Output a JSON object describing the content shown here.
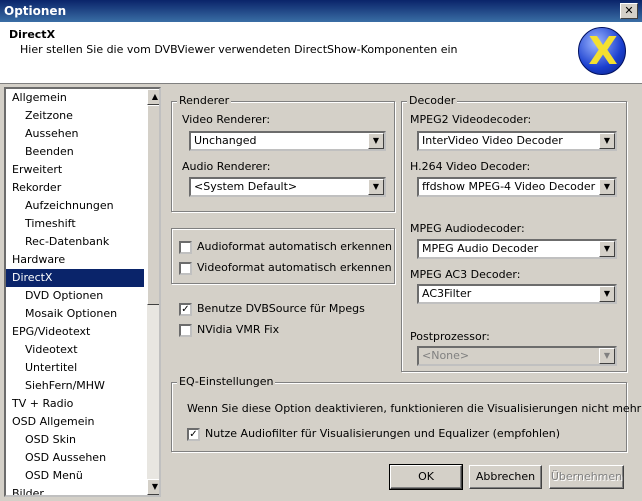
{
  "window": {
    "title": "Optionen"
  },
  "header": {
    "title": "DirectX",
    "subtitle": "Hier stellen Sie die vom DVBViewer verwendeten DirectShow-Komponenten ein"
  },
  "tree": {
    "items": [
      {
        "label": "Allgemein",
        "level": 1
      },
      {
        "label": "Zeitzone",
        "level": 2
      },
      {
        "label": "Aussehen",
        "level": 2
      },
      {
        "label": "Beenden",
        "level": 2
      },
      {
        "label": "Erweitert",
        "level": 1
      },
      {
        "label": "Rekorder",
        "level": 1
      },
      {
        "label": "Aufzeichnungen",
        "level": 2
      },
      {
        "label": "Timeshift",
        "level": 2
      },
      {
        "label": "Rec-Datenbank",
        "level": 2
      },
      {
        "label": "Hardware",
        "level": 1
      },
      {
        "label": "DirectX",
        "level": 1,
        "selected": true
      },
      {
        "label": "DVD Optionen",
        "level": 2
      },
      {
        "label": "Mosaik Optionen",
        "level": 2
      },
      {
        "label": "EPG/Videotext",
        "level": 1
      },
      {
        "label": "Videotext",
        "level": 2
      },
      {
        "label": "Untertitel",
        "level": 2
      },
      {
        "label": "SiehFern/MHW",
        "level": 2
      },
      {
        "label": "TV + Radio",
        "level": 1
      },
      {
        "label": "OSD Allgemein",
        "level": 1
      },
      {
        "label": "OSD Skin",
        "level": 2
      },
      {
        "label": "OSD Aussehen",
        "level": 2
      },
      {
        "label": "OSD Menü",
        "level": 2
      },
      {
        "label": "Bilder",
        "level": 1
      }
    ]
  },
  "renderer": {
    "group_title": "Renderer",
    "video_label": "Video Renderer:",
    "video_value": "Unchanged",
    "audio_label": "Audio Renderer:",
    "audio_value": "<System Default>"
  },
  "autodetect": {
    "audio_label": "Audioformat automatisch erkennen",
    "audio_checked": false,
    "video_label": "Videoformat automatisch erkennen",
    "video_checked": false
  },
  "misc": {
    "dvbsource_label": "Benutze DVBSource für Mpegs",
    "dvbsource_checked": true,
    "vmr_label": "NVidia VMR Fix",
    "vmr_checked": false
  },
  "decoder": {
    "group_title": "Decoder",
    "mpeg2_label": "MPEG2 Videodecoder:",
    "mpeg2_value": "InterVideo Video Decoder",
    "h264_label": "H.264 Video Decoder:",
    "h264_value": "ffdshow MPEG-4 Video Decoder",
    "mpeg_audio_label": "MPEG Audiodecoder:",
    "mpeg_audio_value": "MPEG Audio Decoder",
    "ac3_label": "MPEG AC3 Decoder:",
    "ac3_value": "AC3Filter",
    "post_label": "Postprozessor:",
    "post_value": "<None>"
  },
  "eq": {
    "group_title": "EQ-Einstellungen",
    "info": "Wenn Sie diese Option deaktivieren, funktionieren die Visualisierungen nicht mehr!",
    "filter_label": "Nutze Audiofilter für Visualisierungen und Equalizer (empfohlen)",
    "filter_checked": true
  },
  "buttons": {
    "ok": "OK",
    "cancel": "Abbrechen",
    "apply": "Übernehmen"
  },
  "icons": {
    "close": "close-icon",
    "logo": "directx-logo-icon",
    "dropdown": "chevron-down-icon",
    "check": "checkmark-icon"
  }
}
